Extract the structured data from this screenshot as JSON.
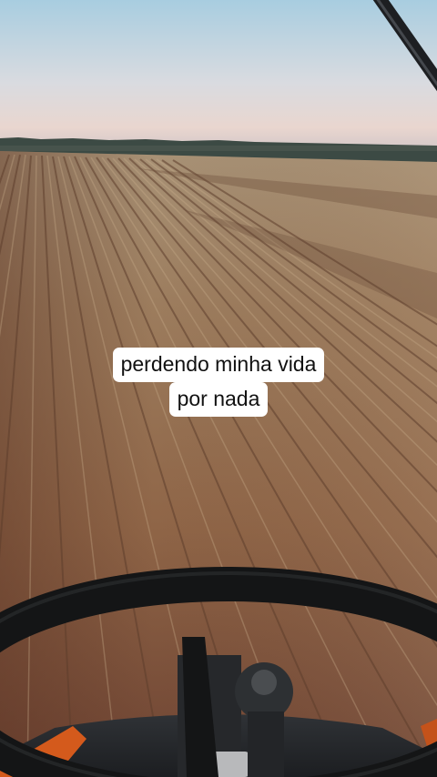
{
  "caption": {
    "line1": "perdendo minha vida",
    "line2": "por nada"
  }
}
